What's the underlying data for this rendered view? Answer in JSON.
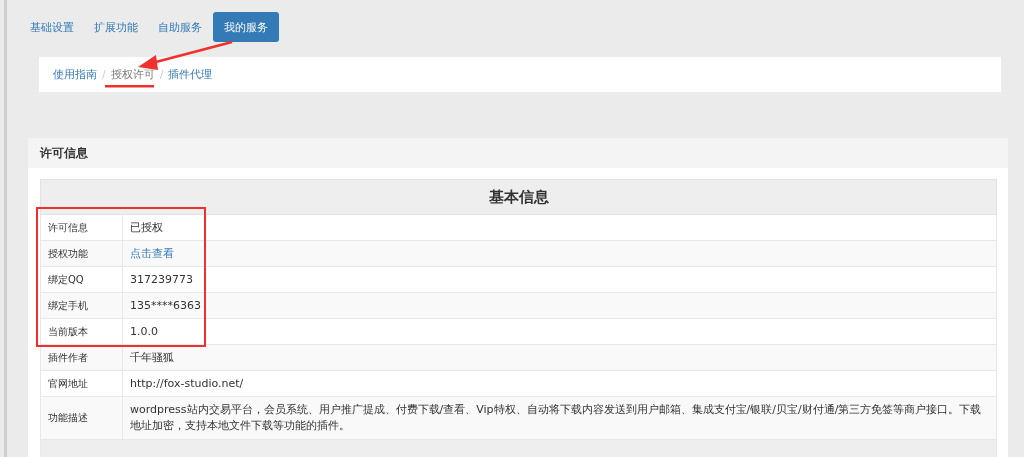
{
  "tabs": [
    {
      "label": "基础设置",
      "selected": false
    },
    {
      "label": "扩展功能",
      "selected": false
    },
    {
      "label": "自助服务",
      "selected": false
    },
    {
      "label": "我的服务",
      "selected": true
    }
  ],
  "breadcrumb_separator": "/",
  "breadcrumb": [
    {
      "label": "使用指南",
      "selected": false
    },
    {
      "label": "授权许可",
      "selected": true
    },
    {
      "label": "插件代理",
      "selected": false
    }
  ],
  "panel": {
    "title": "许可信息",
    "table": {
      "heading": "基本信息",
      "rows": [
        {
          "label": "许可信息",
          "value": "已授权",
          "kind": "text"
        },
        {
          "label": "授权功能",
          "value": "点击查看",
          "kind": "link"
        },
        {
          "label": "绑定QQ",
          "value": "317239773",
          "kind": "text"
        },
        {
          "label": "绑定手机",
          "value": "135****6363",
          "kind": "text"
        },
        {
          "label": "当前版本",
          "value": "1.0.0",
          "kind": "text"
        },
        {
          "label": "插件作者",
          "value": "千年骚狐",
          "kind": "text"
        },
        {
          "label": "官网地址",
          "value": "http://fox-studio.net/",
          "kind": "text"
        },
        {
          "label": "功能描述",
          "value": "wordpress站内交易平台，会员系统、用户推广提成、付费下载/查看、Vip特权、自动将下载内容发送到用户邮箱、集成支付宝/银联/贝宝/财付通/第三方免签等商户接口。下载地址加密，支持本地文件下载等功能的插件。",
          "kind": "text"
        }
      ]
    }
  }
}
